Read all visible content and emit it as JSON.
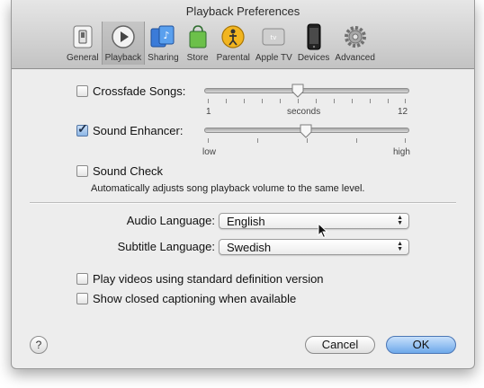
{
  "window": {
    "title": "Playback Preferences"
  },
  "toolbar": {
    "items": [
      {
        "label": "General",
        "icon": "general-switch-icon"
      },
      {
        "label": "Playback",
        "icon": "play-icon",
        "selected": true
      },
      {
        "label": "Sharing",
        "icon": "sharing-icon"
      },
      {
        "label": "Store",
        "icon": "shopping-bag-icon"
      },
      {
        "label": "Parental",
        "icon": "parental-icon"
      },
      {
        "label": "Apple TV",
        "icon": "apple-tv-icon"
      },
      {
        "label": "Devices",
        "icon": "iphone-icon"
      },
      {
        "label": "Advanced",
        "icon": "gear-icon"
      }
    ]
  },
  "crossfade": {
    "label": "Crossfade Songs:",
    "checked": false,
    "min_label": "1",
    "unit_label": "seconds",
    "max_label": "12",
    "value": 6
  },
  "sound_enhancer": {
    "label": "Sound Enhancer:",
    "checked": true,
    "low_label": "low",
    "high_label": "high",
    "value_fraction": 0.5
  },
  "sound_check": {
    "label": "Sound Check",
    "checked": false,
    "description": "Automatically adjusts song playback volume to the same level."
  },
  "audio_language": {
    "label": "Audio Language:",
    "value": "English"
  },
  "subtitle_language": {
    "label": "Subtitle Language:",
    "value": "Swedish"
  },
  "options": {
    "standard_definition": {
      "label": "Play videos using standard definition version",
      "checked": false
    },
    "closed_captioning": {
      "label": "Show closed captioning when available",
      "checked": false
    }
  },
  "buttons": {
    "help": "?",
    "cancel": "Cancel",
    "ok": "OK"
  },
  "colors": {
    "accent": "#6ea8ea",
    "window_bg": "#ededed"
  }
}
